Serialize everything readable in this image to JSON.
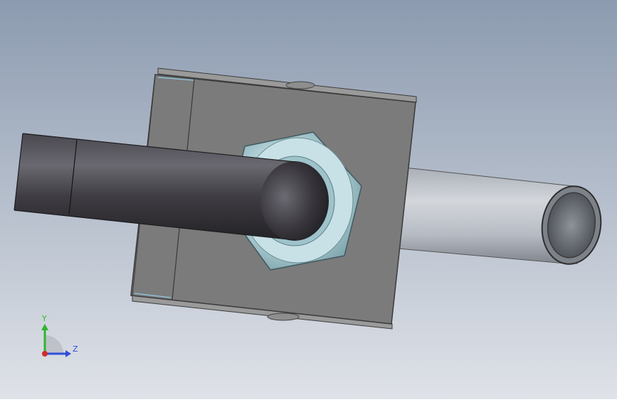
{
  "viewport": {
    "background_top": "#8c9bb0",
    "background_bottom": "#dfe2e8",
    "model": {
      "parts": [
        "block",
        "bent-tube",
        "hex-nut",
        "straight-tube"
      ],
      "colors": {
        "block_face": "#7a7a7a",
        "block_edge": "#3c3c3c",
        "tube_dark": "#3a383e",
        "tube_light": "#c9ced5",
        "nut": "#b5d3d9"
      }
    }
  },
  "triad": {
    "y_label": "Y",
    "z_label": "Z",
    "y_color": "#2fb52f",
    "z_color": "#2f4fd8",
    "x_color": "#d42a2a"
  }
}
